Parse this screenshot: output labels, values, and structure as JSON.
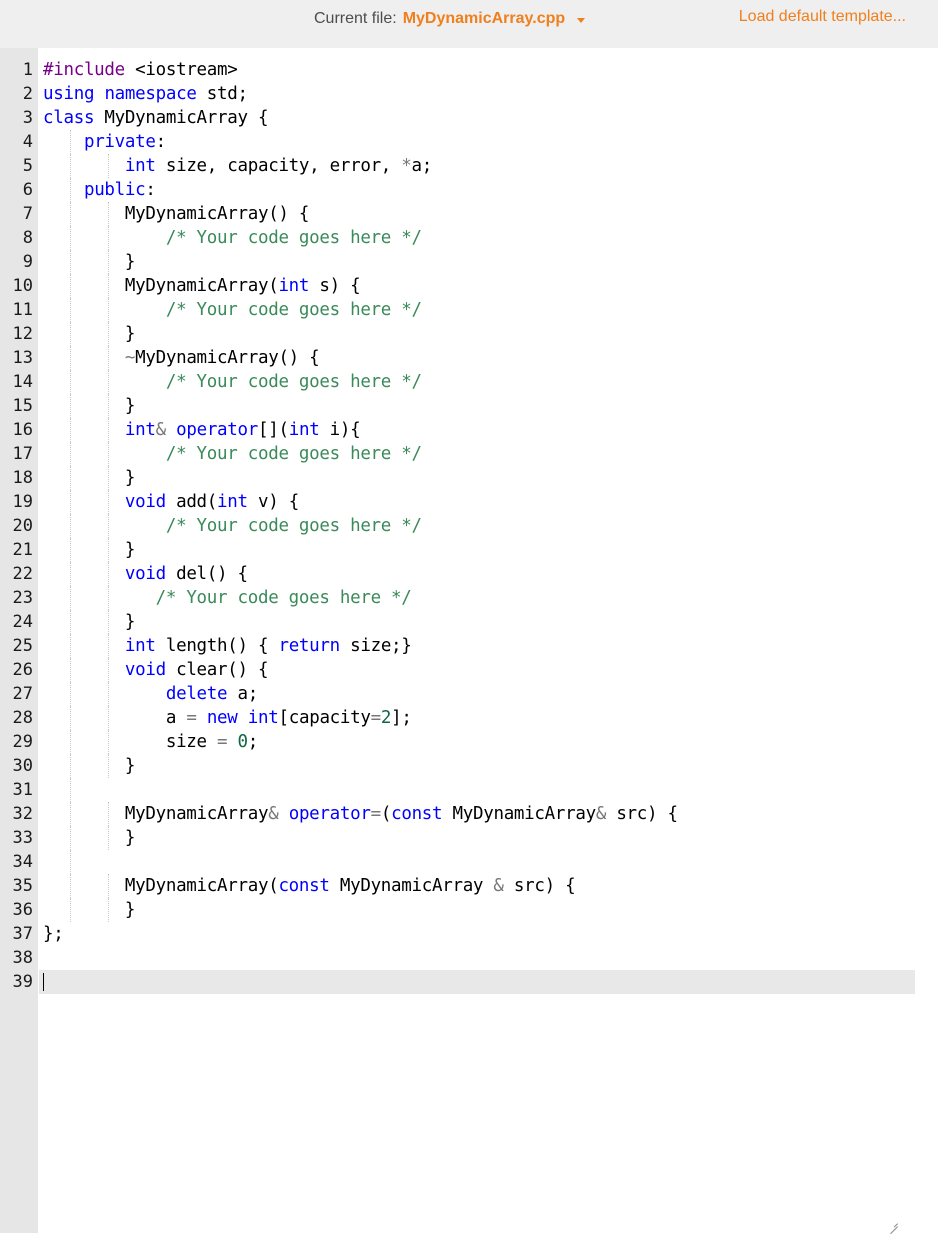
{
  "header": {
    "current_file_label": "Current file:",
    "current_file_name": "MyDynamicArray.cpp",
    "load_template_label": "Load default template..."
  },
  "colors": {
    "accent": "#f07f1d",
    "keyword": "#0000ff",
    "comment": "#3a8a5a",
    "gutter": "#e6e6e6",
    "active_line": "#e8e8e8"
  },
  "editor": {
    "active_line": 39,
    "lines": [
      "#include <iostream>",
      "using namespace std;",
      "class MyDynamicArray {",
      "    private:",
      "        int size, capacity, error, *a;",
      "    public:",
      "        MyDynamicArray() {",
      "            /* Your code goes here */",
      "        }",
      "        MyDynamicArray(int s) {",
      "            /* Your code goes here */",
      "        }",
      "        ~MyDynamicArray() {",
      "            /* Your code goes here */",
      "        }",
      "        int& operator[](int i){",
      "            /* Your code goes here */",
      "        }",
      "        void add(int v) {",
      "            /* Your code goes here */",
      "        }",
      "        void del() {",
      "           /* Your code goes here */",
      "        }",
      "        int length() { return size;}",
      "        void clear() {",
      "            delete a;",
      "            a = new int[capacity=2];",
      "            size = 0;",
      "        }",
      "",
      "        MyDynamicArray& operator=(const MyDynamicArray& src) {",
      "        }",
      "",
      "        MyDynamicArray(const MyDynamicArray & src) {",
      "        }",
      "};",
      "",
      ""
    ]
  }
}
